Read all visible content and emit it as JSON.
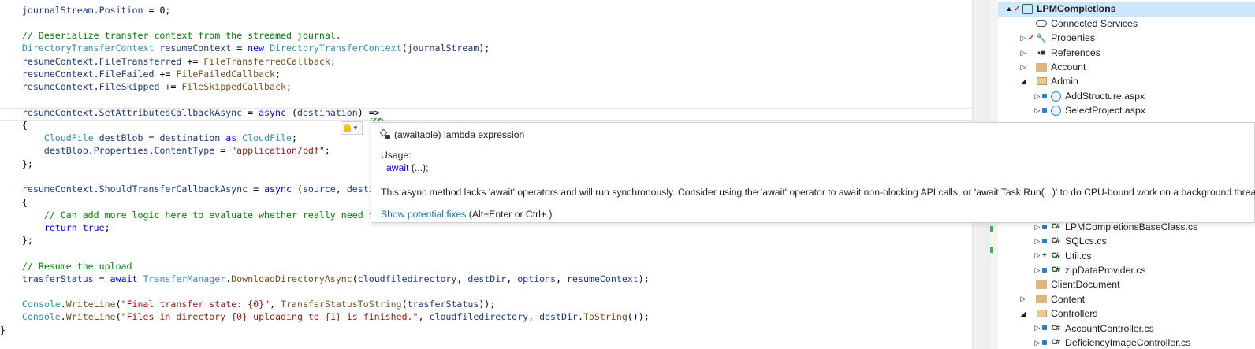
{
  "editor": {
    "lines": [
      [
        [
          "plain",
          "    "
        ],
        [
          "id",
          "journalStream"
        ],
        [
          "plain",
          "."
        ],
        [
          "id",
          "Position"
        ],
        [
          "plain",
          " = 0;"
        ]
      ],
      [],
      [
        [
          "plain",
          "    "
        ],
        [
          "cmt",
          "// Deserialize transfer context from the streamed journal."
        ]
      ],
      [
        [
          "plain",
          "    "
        ],
        [
          "ty",
          "DirectoryTransferContext"
        ],
        [
          "plain",
          " "
        ],
        [
          "id",
          "resumeContext"
        ],
        [
          "plain",
          " = "
        ],
        [
          "kw",
          "new"
        ],
        [
          "plain",
          " "
        ],
        [
          "ty",
          "DirectoryTransferContext"
        ],
        [
          "plain",
          "("
        ],
        [
          "id",
          "journalStream"
        ],
        [
          "plain",
          ");"
        ]
      ],
      [
        [
          "plain",
          "    "
        ],
        [
          "id",
          "resumeContext"
        ],
        [
          "plain",
          "."
        ],
        [
          "id",
          "FileTransferred"
        ],
        [
          "plain",
          " += "
        ],
        [
          "mth",
          "FileTransferredCallback"
        ],
        [
          "plain",
          ";"
        ]
      ],
      [
        [
          "plain",
          "    "
        ],
        [
          "id",
          "resumeContext"
        ],
        [
          "plain",
          "."
        ],
        [
          "id",
          "FileFailed"
        ],
        [
          "plain",
          " += "
        ],
        [
          "mth",
          "FileFailedCallback"
        ],
        [
          "plain",
          ";"
        ]
      ],
      [
        [
          "plain",
          "    "
        ],
        [
          "id",
          "resumeContext"
        ],
        [
          "plain",
          "."
        ],
        [
          "id",
          "FileSkipped"
        ],
        [
          "plain",
          " += "
        ],
        [
          "mth",
          "FileSkippedCallback"
        ],
        [
          "plain",
          ";"
        ]
      ],
      [],
      [
        [
          "plain",
          "    "
        ],
        [
          "id",
          "resumeContext"
        ],
        [
          "plain",
          "."
        ],
        [
          "id",
          "SetAttributesCallbackAsync"
        ],
        [
          "plain",
          " = "
        ],
        [
          "kw",
          "async"
        ],
        [
          "plain",
          " ("
        ],
        [
          "id",
          "destination"
        ],
        [
          "plain",
          ") =>"
        ]
      ],
      [
        [
          "plain",
          "    {"
        ]
      ],
      [
        [
          "plain",
          "        "
        ],
        [
          "ty",
          "CloudFile"
        ],
        [
          "plain",
          " "
        ],
        [
          "id",
          "destBlob"
        ],
        [
          "plain",
          " = "
        ],
        [
          "id",
          "destination"
        ],
        [
          "plain",
          " "
        ],
        [
          "kw",
          "as"
        ],
        [
          "plain",
          " "
        ],
        [
          "ty",
          "CloudFile"
        ],
        [
          "plain",
          ";"
        ]
      ],
      [
        [
          "plain",
          "        "
        ],
        [
          "id",
          "destBlob"
        ],
        [
          "plain",
          "."
        ],
        [
          "id",
          "Properties"
        ],
        [
          "plain",
          "."
        ],
        [
          "id",
          "ContentType"
        ],
        [
          "plain",
          " = "
        ],
        [
          "str",
          "\"application/pdf\""
        ],
        [
          "plain",
          ";"
        ]
      ],
      [
        [
          "plain",
          "    };"
        ]
      ],
      [],
      [
        [
          "plain",
          "    "
        ],
        [
          "id",
          "resumeContext"
        ],
        [
          "plain",
          "."
        ],
        [
          "id",
          "ShouldTransferCallbackAsync"
        ],
        [
          "plain",
          " = "
        ],
        [
          "kw",
          "async"
        ],
        [
          "plain",
          " ("
        ],
        [
          "id",
          "source"
        ],
        [
          "plain",
          ", "
        ],
        [
          "id",
          "desti"
        ]
      ],
      [
        [
          "plain",
          "    {"
        ]
      ],
      [
        [
          "plain",
          "        "
        ],
        [
          "cmt",
          "// Can add more logic here to evaluate whether really need t"
        ]
      ],
      [
        [
          "plain",
          "        "
        ],
        [
          "kw",
          "return"
        ],
        [
          "plain",
          " "
        ],
        [
          "kw",
          "true"
        ],
        [
          "plain",
          ";"
        ]
      ],
      [
        [
          "plain",
          "    };"
        ]
      ],
      [],
      [
        [
          "plain",
          "    "
        ],
        [
          "cmt",
          "// Resume the upload"
        ]
      ],
      [
        [
          "plain",
          "    "
        ],
        [
          "id",
          "trasferStatus"
        ],
        [
          "plain",
          " = "
        ],
        [
          "kw",
          "await"
        ],
        [
          "plain",
          " "
        ],
        [
          "ty",
          "TransferManager"
        ],
        [
          "plain",
          "."
        ],
        [
          "mth",
          "DownloadDirectoryAsync"
        ],
        [
          "plain",
          "("
        ],
        [
          "id",
          "cloudfiledirectory"
        ],
        [
          "plain",
          ", "
        ],
        [
          "id",
          "destDir"
        ],
        [
          "plain",
          ", "
        ],
        [
          "id",
          "options"
        ],
        [
          "plain",
          ", "
        ],
        [
          "id",
          "resumeContext"
        ],
        [
          "plain",
          ");"
        ]
      ],
      [],
      [
        [
          "plain",
          "    "
        ],
        [
          "ty",
          "Console"
        ],
        [
          "plain",
          "."
        ],
        [
          "mth",
          "WriteLine"
        ],
        [
          "plain",
          "("
        ],
        [
          "str",
          "\"Final transfer state: {0}\""
        ],
        [
          "plain",
          ", "
        ],
        [
          "mth",
          "TransferStatusToString"
        ],
        [
          "plain",
          "("
        ],
        [
          "id",
          "trasferStatus"
        ],
        [
          "plain",
          "));"
        ]
      ],
      [
        [
          "plain",
          "    "
        ],
        [
          "ty",
          "Console"
        ],
        [
          "plain",
          "."
        ],
        [
          "mth",
          "WriteLine"
        ],
        [
          "plain",
          "("
        ],
        [
          "str",
          "\"Files in directory {0} uploading to {1} is finished.\""
        ],
        [
          "plain",
          ", "
        ],
        [
          "id",
          "cloudfiledirectory"
        ],
        [
          "plain",
          ", "
        ],
        [
          "id",
          "destDir"
        ],
        [
          "plain",
          "."
        ],
        [
          "mth",
          "ToString"
        ],
        [
          "plain",
          "());"
        ]
      ],
      [
        [
          "plain",
          "}"
        ]
      ]
    ]
  },
  "quickinfo": {
    "signature": "(awaitable) lambda expression",
    "usage_label": "Usage:",
    "usage_await": "await",
    "usage_rest": " (...);",
    "message": "This async method lacks 'await' operators and will run synchronously. Consider using the 'await' operator to await non-blocking API calls, or 'await Task.Run(...)' to do CPU-bound work on a background thread.",
    "fixes_link": "Show potential fixes",
    "fixes_shortcut": " (Alt+Enter or Ctrl+.)"
  },
  "solution_explorer": {
    "items": [
      {
        "label": "LPMCompletions",
        "arrow": "▲",
        "badge": "check",
        "icon": "project",
        "indent": 0,
        "selected": true
      },
      {
        "label": "Connected Services",
        "arrow": "",
        "badge": "",
        "icon": "cloud",
        "indent": 1
      },
      {
        "label": "Properties",
        "arrow": "▷",
        "badge": "check",
        "icon": "wrench",
        "indent": 1
      },
      {
        "label": "References",
        "arrow": "▷",
        "badge": "",
        "icon": "refs",
        "indent": 1
      },
      {
        "label": "Account",
        "arrow": "▷",
        "badge": "",
        "icon": "folder",
        "indent": 1
      },
      {
        "label": "Admin",
        "arrow": "◢",
        "badge": "",
        "icon": "folder-open",
        "indent": 1
      },
      {
        "label": "AddStructure.aspx",
        "arrow": "▷",
        "badge": "lock",
        "icon": "aspx",
        "indent": 2
      },
      {
        "label": "SelectProject.aspx",
        "arrow": "▷",
        "badge": "lock",
        "icon": "aspx",
        "indent": 2
      },
      {
        "label": "LPMCompletionsBaseClass.cs",
        "arrow": "▷",
        "badge": "lock",
        "icon": "cs",
        "indent": 2,
        "top_override": 287
      },
      {
        "label": "SQLcs.cs",
        "arrow": "▷",
        "badge": "lock",
        "icon": "cs",
        "indent": 2
      },
      {
        "label": "Util.cs",
        "arrow": "▷",
        "badge": "plus",
        "icon": "cs",
        "indent": 2
      },
      {
        "label": "zipDataProvider.cs",
        "arrow": "▷",
        "badge": "lock",
        "icon": "cs",
        "indent": 2
      },
      {
        "label": "ClientDocument",
        "arrow": "",
        "badge": "",
        "icon": "folder",
        "indent": 1
      },
      {
        "label": "Content",
        "arrow": "▷",
        "badge": "",
        "icon": "folder",
        "indent": 1
      },
      {
        "label": "Controllers",
        "arrow": "◢",
        "badge": "",
        "icon": "folder-open",
        "indent": 1
      },
      {
        "label": "AccountController.cs",
        "arrow": "▷",
        "badge": "lock",
        "icon": "cs",
        "indent": 2
      },
      {
        "label": "DeficiencyImageController.cs",
        "arrow": "▷",
        "badge": "lock",
        "icon": "cs",
        "indent": 2
      }
    ],
    "cs_icon_text": "C#"
  }
}
